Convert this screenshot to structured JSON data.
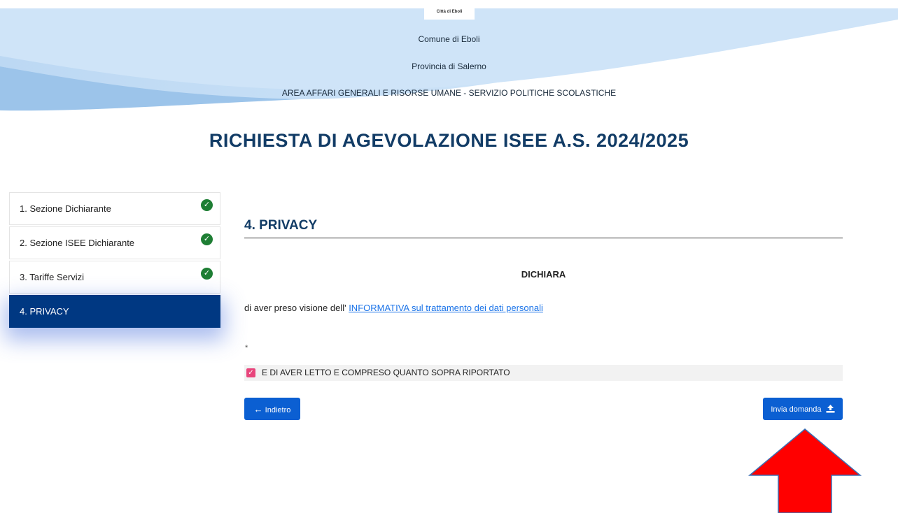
{
  "header": {
    "logo_text": "Città di Eboli",
    "line1": "Comune di Eboli",
    "line2": "Provincia di Salerno",
    "line3": "AREA AFFARI GENERALI E RISORSE UMANE - SERVIZIO POLITICHE SCOLASTICHE"
  },
  "title": "RICHIESTA DI AGEVOLAZIONE ISEE A.S. 2024/2025",
  "steps": [
    {
      "label": "1. Sezione Dichiarante",
      "completed": true
    },
    {
      "label": "2. Sezione ISEE Dichiarante",
      "completed": true
    },
    {
      "label": "3. Tariffe Servizi",
      "completed": true
    },
    {
      "label": "4. PRIVACY",
      "completed": false,
      "active": true
    }
  ],
  "section": {
    "title": "4. PRIVACY",
    "dichiara": "DICHIARA",
    "text_prefix": "di aver preso visione dell'",
    "link": "INFORMATIVA sul trattamento dei dati personali",
    "required_mark": "*",
    "consent_label": "E DI AVER LETTO E COMPRESO QUANTO SOPRA RIPORTATO",
    "consent_checked": true
  },
  "buttons": {
    "back": "Indietro",
    "send": "Invia domanda"
  },
  "colors": {
    "primary": "#0b5fd2",
    "active_step": "#003882",
    "check": "#1e7e34",
    "checkbox": "#e8457c",
    "annotation_arrow": "#ff0000"
  },
  "icons": {
    "back": "arrow-left-icon",
    "send": "upload-icon",
    "step_done": "check-circle-icon"
  }
}
